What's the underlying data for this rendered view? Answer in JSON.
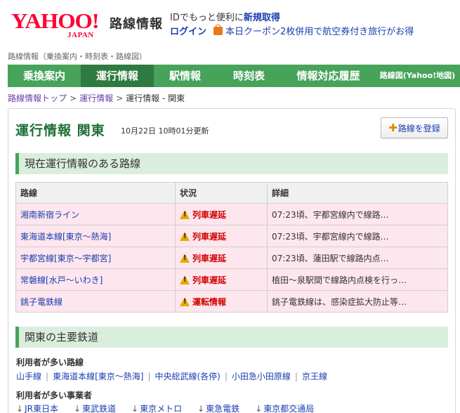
{
  "header": {
    "logo_main": "YAHOO!",
    "logo_sub": "JAPAN",
    "service_name": "路線情報",
    "promo_text": "IDでもっと便利に",
    "promo_link": "新規取得",
    "login": "ログイン",
    "coupon_text": "本日クーポン2枚併用で航空券付き旅行がお得",
    "coupon_icon": "bag-icon"
  },
  "top_crumb": "路線情報（乗換案内・時刻表・路線図）",
  "nav": {
    "items": [
      "乗換案内",
      "運行情報",
      "駅情報",
      "時刻表",
      "情報対応履歴",
      "路線図(Yahoo!地図)"
    ],
    "active_index": 1,
    "color": "#47a35a",
    "active_color": "#2e7a40"
  },
  "breadcrumb": {
    "items": [
      "路線情報トップ",
      "運行情報",
      "運行情報 - 関東"
    ],
    "separator": ">"
  },
  "page": {
    "title": "運行情報 関東",
    "updated": "10月22日 10時01分更新",
    "register_label": "路線を登録",
    "register_icon": "plus-icon"
  },
  "status_section": {
    "heading": "現在運行情報のある路線",
    "columns": [
      "路線",
      "状況",
      "詳細"
    ],
    "rows": [
      {
        "line": "湘南新宿ライン",
        "status": "列車遅延",
        "detail": "07:23頃、宇都宮線内で線路…"
      },
      {
        "line": "東海道本線[東京～熱海]",
        "status": "列車遅延",
        "detail": "07:23頃、宇都宮線内で線路…"
      },
      {
        "line": "宇都宮線[東京～宇都宮]",
        "status": "列車遅延",
        "detail": "07:23頃、蓮田駅で線路内点…"
      },
      {
        "line": "常磐線[水戸～いわき]",
        "status": "列車遅延",
        "detail": "植田～泉駅間で線路内点検を行っ…"
      },
      {
        "line": "銚子電鉄線",
        "status": "運転情報",
        "detail": "銚子電鉄線は、感染症拡大防止等…"
      }
    ],
    "status_icon": "warning-icon",
    "row_color": "#fde6ed"
  },
  "major_section": {
    "heading": "関東の主要鉄道",
    "popular_lines_label": "利用者が多い路線",
    "popular_lines": [
      "山手線",
      "東海道本線[東京～熱海]",
      "中央総武線(各停)",
      "小田急小田原線",
      "京王線"
    ],
    "popular_companies_label": "利用者が多い事業者",
    "popular_companies": [
      "JR東日本",
      "東武鉄道",
      "東京メトロ",
      "東急電鉄",
      "東京都交通局"
    ]
  }
}
